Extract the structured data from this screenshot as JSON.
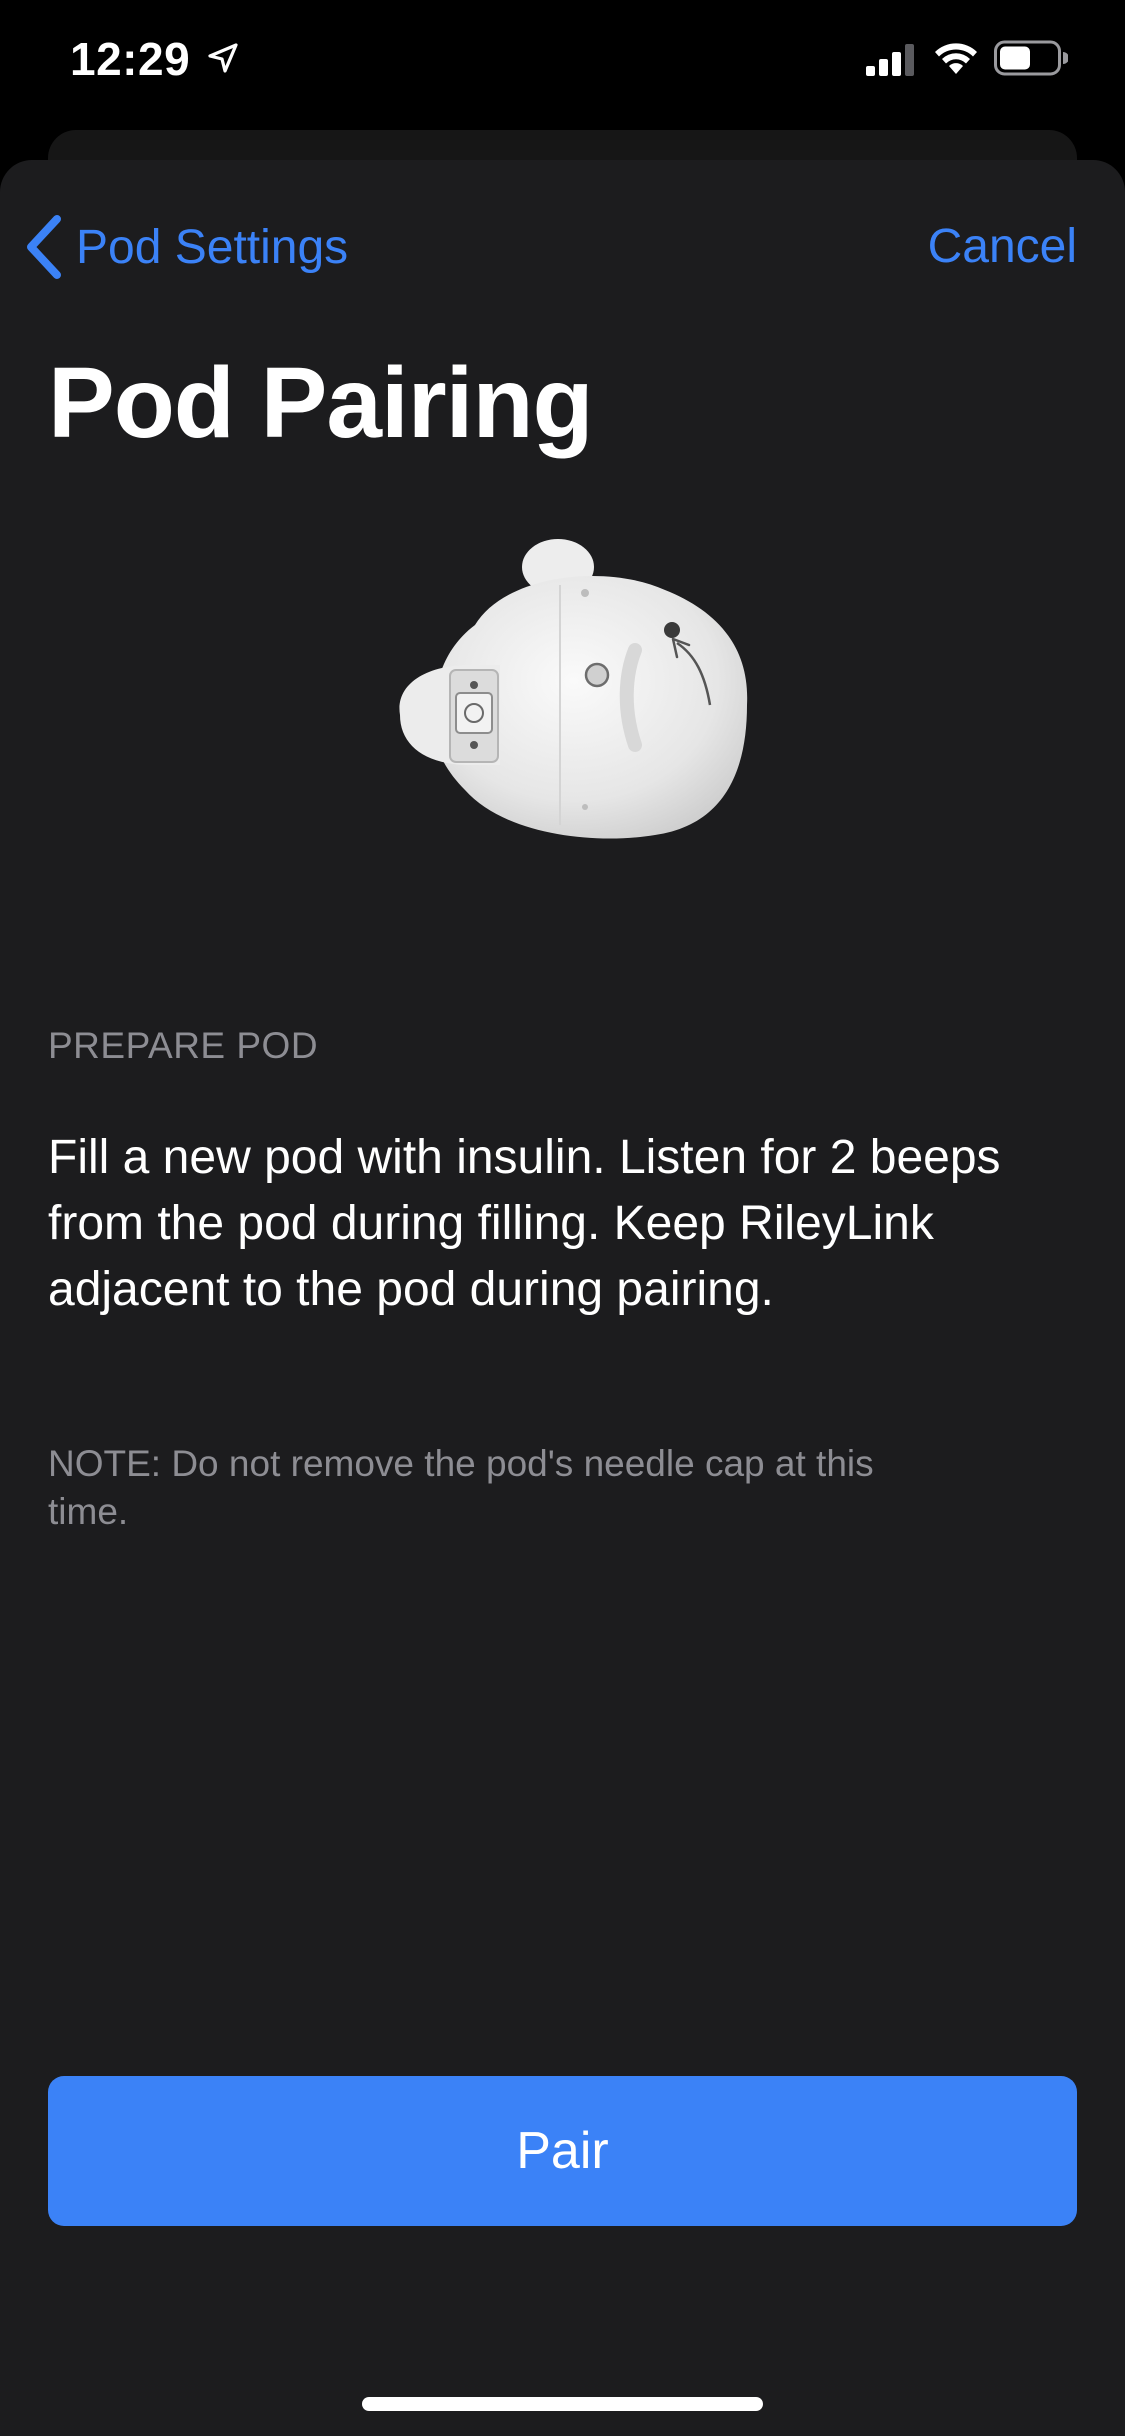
{
  "status_bar": {
    "time": "12:29",
    "location_icon": "location-arrow-icon",
    "signal_icon": "cellular-signal-icon",
    "wifi_icon": "wifi-icon",
    "battery_icon": "battery-icon"
  },
  "nav": {
    "back_label": "Pod Settings",
    "cancel_label": "Cancel"
  },
  "title": "Pod Pairing",
  "illustration_icon": "omnipod-pod-icon",
  "section": {
    "header": "PREPARE POD",
    "instructions": "Fill a new pod with insulin. Listen for 2 beeps from the pod during filling. Keep RileyLink adjacent to the pod during pairing.",
    "note": "NOTE: Do not remove the pod's needle cap at this time."
  },
  "actions": {
    "pair_label": "Pair"
  },
  "colors": {
    "accent": "#3b82f7",
    "sheet_background": "#1c1c1e",
    "secondary_text": "#8d8d93"
  }
}
